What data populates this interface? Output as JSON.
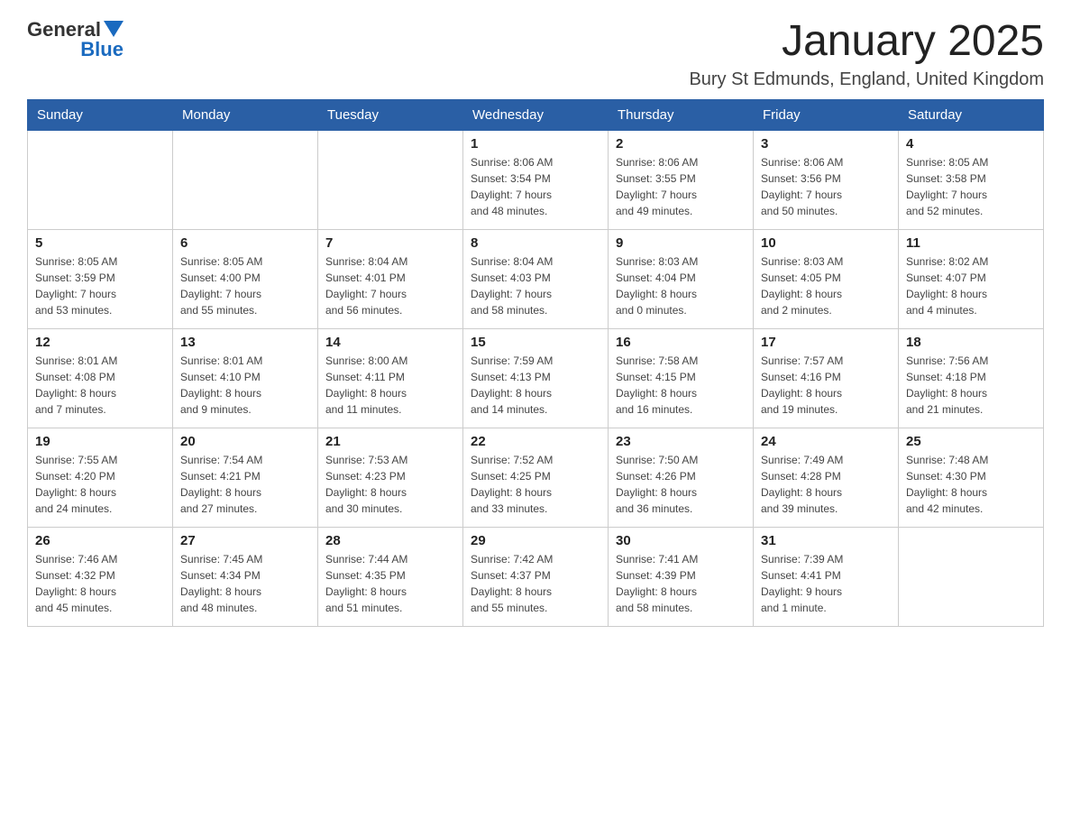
{
  "header": {
    "logo_general": "General",
    "logo_blue": "Blue",
    "month_title": "January 2025",
    "location": "Bury St Edmunds, England, United Kingdom"
  },
  "days_of_week": [
    "Sunday",
    "Monday",
    "Tuesday",
    "Wednesday",
    "Thursday",
    "Friday",
    "Saturday"
  ],
  "weeks": [
    [
      {
        "day": "",
        "info": ""
      },
      {
        "day": "",
        "info": ""
      },
      {
        "day": "",
        "info": ""
      },
      {
        "day": "1",
        "info": "Sunrise: 8:06 AM\nSunset: 3:54 PM\nDaylight: 7 hours\nand 48 minutes."
      },
      {
        "day": "2",
        "info": "Sunrise: 8:06 AM\nSunset: 3:55 PM\nDaylight: 7 hours\nand 49 minutes."
      },
      {
        "day": "3",
        "info": "Sunrise: 8:06 AM\nSunset: 3:56 PM\nDaylight: 7 hours\nand 50 minutes."
      },
      {
        "day": "4",
        "info": "Sunrise: 8:05 AM\nSunset: 3:58 PM\nDaylight: 7 hours\nand 52 minutes."
      }
    ],
    [
      {
        "day": "5",
        "info": "Sunrise: 8:05 AM\nSunset: 3:59 PM\nDaylight: 7 hours\nand 53 minutes."
      },
      {
        "day": "6",
        "info": "Sunrise: 8:05 AM\nSunset: 4:00 PM\nDaylight: 7 hours\nand 55 minutes."
      },
      {
        "day": "7",
        "info": "Sunrise: 8:04 AM\nSunset: 4:01 PM\nDaylight: 7 hours\nand 56 minutes."
      },
      {
        "day": "8",
        "info": "Sunrise: 8:04 AM\nSunset: 4:03 PM\nDaylight: 7 hours\nand 58 minutes."
      },
      {
        "day": "9",
        "info": "Sunrise: 8:03 AM\nSunset: 4:04 PM\nDaylight: 8 hours\nand 0 minutes."
      },
      {
        "day": "10",
        "info": "Sunrise: 8:03 AM\nSunset: 4:05 PM\nDaylight: 8 hours\nand 2 minutes."
      },
      {
        "day": "11",
        "info": "Sunrise: 8:02 AM\nSunset: 4:07 PM\nDaylight: 8 hours\nand 4 minutes."
      }
    ],
    [
      {
        "day": "12",
        "info": "Sunrise: 8:01 AM\nSunset: 4:08 PM\nDaylight: 8 hours\nand 7 minutes."
      },
      {
        "day": "13",
        "info": "Sunrise: 8:01 AM\nSunset: 4:10 PM\nDaylight: 8 hours\nand 9 minutes."
      },
      {
        "day": "14",
        "info": "Sunrise: 8:00 AM\nSunset: 4:11 PM\nDaylight: 8 hours\nand 11 minutes."
      },
      {
        "day": "15",
        "info": "Sunrise: 7:59 AM\nSunset: 4:13 PM\nDaylight: 8 hours\nand 14 minutes."
      },
      {
        "day": "16",
        "info": "Sunrise: 7:58 AM\nSunset: 4:15 PM\nDaylight: 8 hours\nand 16 minutes."
      },
      {
        "day": "17",
        "info": "Sunrise: 7:57 AM\nSunset: 4:16 PM\nDaylight: 8 hours\nand 19 minutes."
      },
      {
        "day": "18",
        "info": "Sunrise: 7:56 AM\nSunset: 4:18 PM\nDaylight: 8 hours\nand 21 minutes."
      }
    ],
    [
      {
        "day": "19",
        "info": "Sunrise: 7:55 AM\nSunset: 4:20 PM\nDaylight: 8 hours\nand 24 minutes."
      },
      {
        "day": "20",
        "info": "Sunrise: 7:54 AM\nSunset: 4:21 PM\nDaylight: 8 hours\nand 27 minutes."
      },
      {
        "day": "21",
        "info": "Sunrise: 7:53 AM\nSunset: 4:23 PM\nDaylight: 8 hours\nand 30 minutes."
      },
      {
        "day": "22",
        "info": "Sunrise: 7:52 AM\nSunset: 4:25 PM\nDaylight: 8 hours\nand 33 minutes."
      },
      {
        "day": "23",
        "info": "Sunrise: 7:50 AM\nSunset: 4:26 PM\nDaylight: 8 hours\nand 36 minutes."
      },
      {
        "day": "24",
        "info": "Sunrise: 7:49 AM\nSunset: 4:28 PM\nDaylight: 8 hours\nand 39 minutes."
      },
      {
        "day": "25",
        "info": "Sunrise: 7:48 AM\nSunset: 4:30 PM\nDaylight: 8 hours\nand 42 minutes."
      }
    ],
    [
      {
        "day": "26",
        "info": "Sunrise: 7:46 AM\nSunset: 4:32 PM\nDaylight: 8 hours\nand 45 minutes."
      },
      {
        "day": "27",
        "info": "Sunrise: 7:45 AM\nSunset: 4:34 PM\nDaylight: 8 hours\nand 48 minutes."
      },
      {
        "day": "28",
        "info": "Sunrise: 7:44 AM\nSunset: 4:35 PM\nDaylight: 8 hours\nand 51 minutes."
      },
      {
        "day": "29",
        "info": "Sunrise: 7:42 AM\nSunset: 4:37 PM\nDaylight: 8 hours\nand 55 minutes."
      },
      {
        "day": "30",
        "info": "Sunrise: 7:41 AM\nSunset: 4:39 PM\nDaylight: 8 hours\nand 58 minutes."
      },
      {
        "day": "31",
        "info": "Sunrise: 7:39 AM\nSunset: 4:41 PM\nDaylight: 9 hours\nand 1 minute."
      },
      {
        "day": "",
        "info": ""
      }
    ]
  ]
}
